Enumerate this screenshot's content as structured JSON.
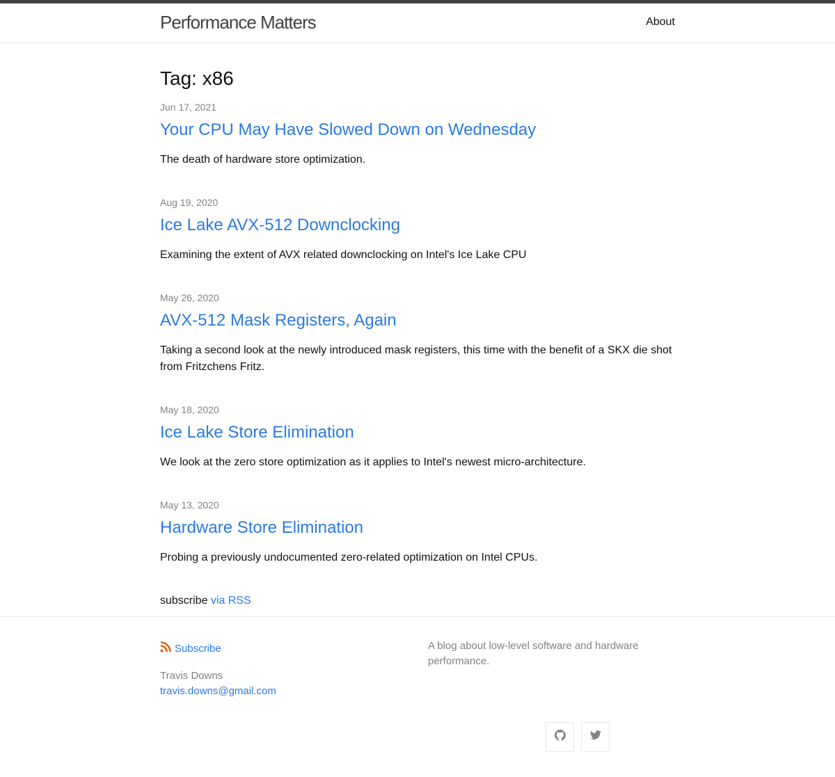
{
  "header": {
    "site_title": "Performance Matters",
    "nav": [
      {
        "label": "About"
      }
    ]
  },
  "page": {
    "heading": "Tag: x86",
    "posts": [
      {
        "date": "Jun 17, 2021",
        "title": "Your CPU May Have Slowed Down on Wednesday",
        "excerpt": "The death of hardware store optimization."
      },
      {
        "date": "Aug 19, 2020",
        "title": "Ice Lake AVX-512 Downclocking",
        "excerpt": "Examining the extent of AVX related downclocking on Intel's Ice Lake CPU"
      },
      {
        "date": "May 26, 2020",
        "title": "AVX-512 Mask Registers, Again",
        "excerpt": "Taking a second look at the newly introduced mask registers, this time with the benefit of a SKX die shot from Fritzchens Fritz."
      },
      {
        "date": "May 18, 2020",
        "title": "Ice Lake Store Elimination",
        "excerpt": "We look at the zero store optimization as it applies to Intel's newest micro-architecture."
      },
      {
        "date": "May 13, 2020",
        "title": "Hardware Store Elimination",
        "excerpt": "Probing a previously undocumented zero-related optimization on Intel CPUs."
      }
    ],
    "subscribe_text": "subscribe",
    "subscribe_link": "via RSS"
  },
  "footer": {
    "subscribe_label": "Subscribe",
    "author_name": "Travis Downs",
    "author_email": "travis.downs@gmail.com",
    "description": "A blog about low-level software and hardware performance.",
    "social_icons": [
      "github-icon",
      "twitter-icon"
    ]
  },
  "colors": {
    "link": "#2a7ae2",
    "meta": "#828282",
    "rss": "#e65c00",
    "top_stripe": "#424242"
  }
}
